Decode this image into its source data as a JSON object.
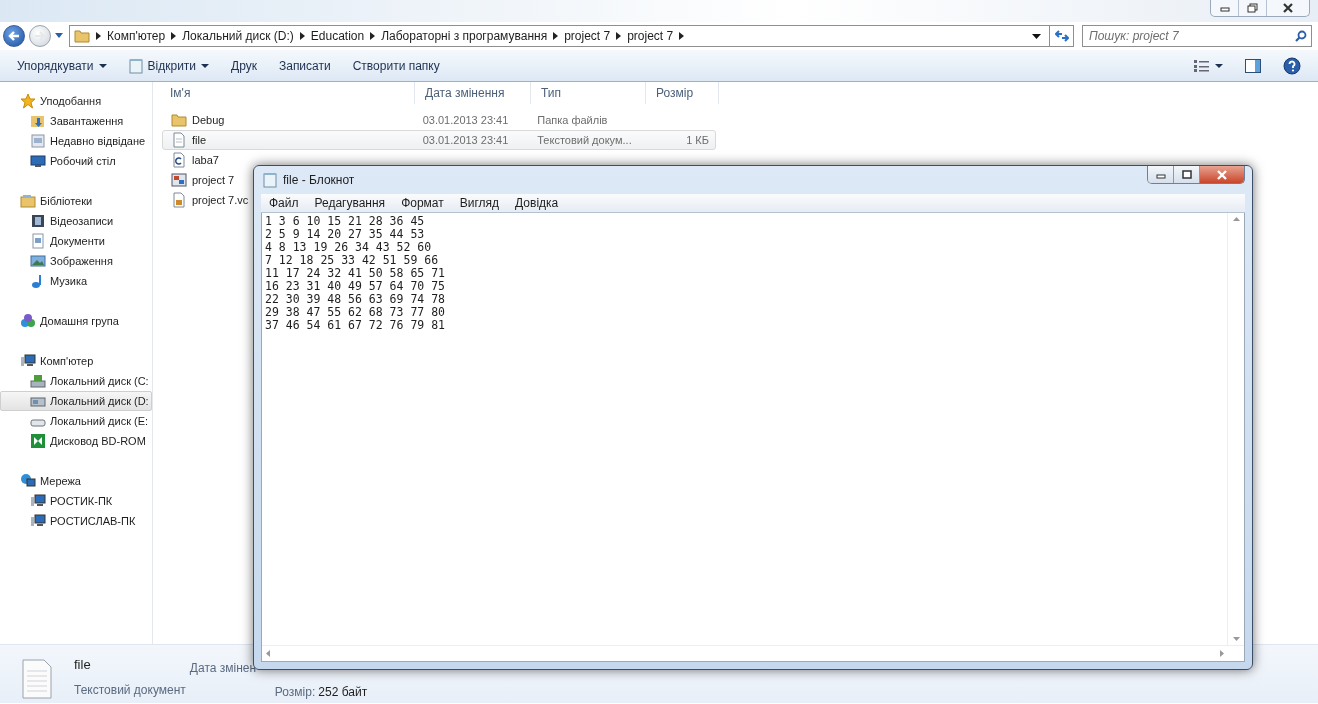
{
  "address_bar": {
    "crumbs": [
      "Комп'ютер",
      "Локальний диск (D:)",
      "Education",
      "Лабораторні з програмування",
      "project 7",
      "project 7"
    ]
  },
  "search": {
    "placeholder": "Пошук: project 7"
  },
  "toolbar": {
    "items": [
      {
        "label": "Упорядкувати",
        "kind": "menu"
      },
      {
        "label": "Відкрити",
        "kind": "app-menu"
      },
      {
        "label": "Друк",
        "kind": "plain"
      },
      {
        "label": "Записати",
        "kind": "plain"
      },
      {
        "label": "Створити папку",
        "kind": "plain"
      }
    ]
  },
  "sidebar": {
    "groups": [
      {
        "label": "Уподобання",
        "kind": "star",
        "children": [
          {
            "label": "Завантаження",
            "kind": "download",
            "selected": false
          },
          {
            "label": "Недавно відвідане",
            "kind": "recent",
            "selected": false
          },
          {
            "label": "Робочий стіл",
            "kind": "desktop",
            "selected": false
          }
        ]
      },
      {
        "label": "Бібліотеки",
        "kind": "library",
        "children": [
          {
            "label": "Відеозаписи",
            "kind": "video",
            "selected": false
          },
          {
            "label": "Документи",
            "kind": "document",
            "selected": false
          },
          {
            "label": "Зображення",
            "kind": "picture",
            "selected": false
          },
          {
            "label": "Музика",
            "kind": "music",
            "selected": false
          }
        ]
      },
      {
        "label": "Домашня група",
        "kind": "homegroup"
      },
      {
        "label": "Комп'ютер",
        "kind": "computer",
        "children": [
          {
            "label": "Локальний диск (C:",
            "kind": "drive-windows",
            "selected": false
          },
          {
            "label": "Локальний диск (D:",
            "kind": "drive",
            "selected": true
          },
          {
            "label": "Локальний диск (E:",
            "kind": "drive-small",
            "selected": false
          },
          {
            "label": "Дисковод BD-ROM",
            "kind": "bd-rom",
            "selected": false
          }
        ]
      },
      {
        "label": "Мережа",
        "kind": "network",
        "children": [
          {
            "label": "РОСТИК-ПК",
            "kind": "computer",
            "selected": false
          },
          {
            "label": "РОСТИСЛАВ-ПК",
            "kind": "computer",
            "selected": false
          }
        ]
      }
    ]
  },
  "file_list": {
    "columns": [
      "Ім'я",
      "Дата змінення",
      "Тип",
      "Розмір"
    ],
    "rows": [
      {
        "name": "Debug",
        "kind": "folder",
        "date": "03.01.2013 23:41",
        "type": "Папка файлів",
        "selected": false
      },
      {
        "name": "file",
        "kind": "text-file",
        "date": "03.01.2013 23:41",
        "type": "Текстовий докум...",
        "size": "1 КБ",
        "selected": true
      },
      {
        "name": "laba7",
        "kind": "c-file",
        "selected": false
      },
      {
        "name": "project 7",
        "kind": "project",
        "selected": false
      },
      {
        "name": "project 7.vc",
        "kind": "vcproj",
        "selected": false
      }
    ]
  },
  "status_bar": {
    "name": "file",
    "type": "Текстовий документ",
    "date_label": "Дата змінен",
    "size_label": "Розмір:",
    "size": "252 байт"
  },
  "notepad": {
    "title": "file - Блокнот",
    "menu": [
      "Файл",
      "Редагування",
      "Формат",
      "Вигляд",
      "Довідка"
    ],
    "lines": [
      "1 3 6 10 15 21 28 36 45",
      "2 5 9 14 20 27 35 44 53",
      "4 8 13 19 26 34 43 52 60",
      "7 12 18 25 33 42 51 59 66",
      "11 17 24 32 41 50 58 65 71",
      "16 23 31 40 49 57 64 70 75",
      "22 30 39 48 56 63 69 74 78",
      "29 38 47 55 62 68 73 77 80",
      "37 46 54 61 67 72 76 79 81"
    ]
  }
}
